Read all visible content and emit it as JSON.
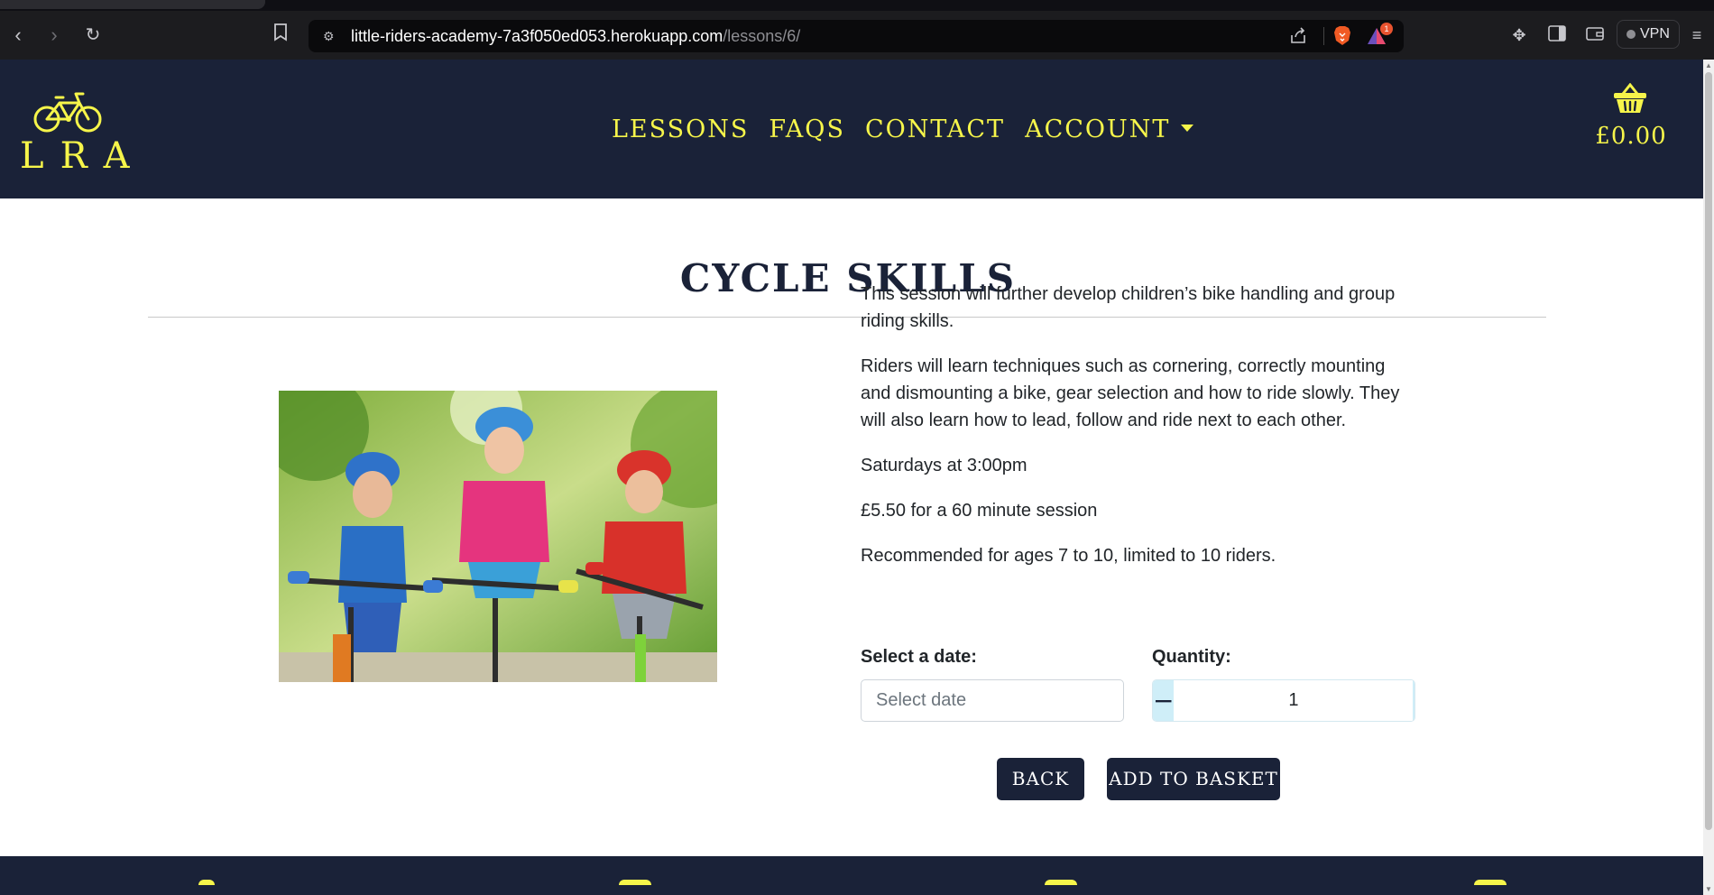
{
  "browser": {
    "url_host": "little-riders-academy-7a3f050ed053.herokuapp.com",
    "url_path": "/lessons/6/",
    "vpn_label": "VPN",
    "rewards_badge": "1"
  },
  "header": {
    "logo_text": "LRA",
    "nav": {
      "lessons": "LESSONS",
      "faqs": "FAQS",
      "contact": "CONTACT",
      "account": "ACCOUNT"
    },
    "basket_total": "£0.00",
    "accent_color": "#f6f54a",
    "brand_color": "#1a2238"
  },
  "lesson": {
    "title": "CYCLE SKILLS",
    "description_1": "This session will further develop children’s bike handling and group riding skills.",
    "description_2": "Riders will learn techniques such as cornering, correctly mounting and dismounting a bike, gear selection and how to ride slowly. They will also learn how to lead, follow and ride next to each other.",
    "schedule": "Saturdays at 3:00pm",
    "price": "£5.50 for a 60 minute session",
    "recommendation": "Recommended for ages 7 to 10, limited to 10 riders."
  },
  "form": {
    "date_label": "Select a date:",
    "date_placeholder": "Select date",
    "quantity_label": "Quantity:",
    "quantity_value": "1",
    "minus_symbol": "−",
    "plus_symbol": "+",
    "back_label": "BACK",
    "add_label": "ADD TO BASKET"
  }
}
